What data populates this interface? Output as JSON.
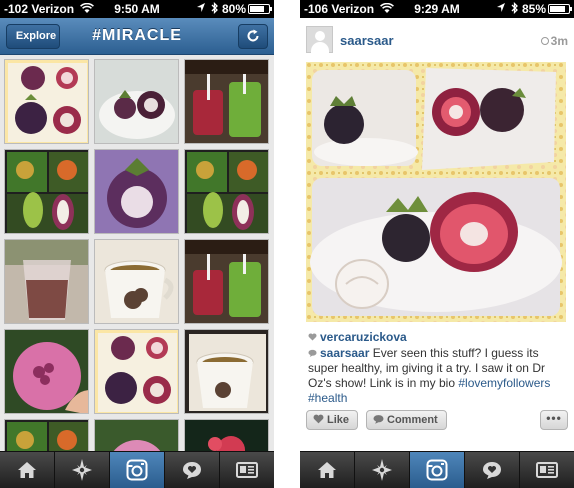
{
  "left_screen": {
    "status_bar": {
      "carrier": "-102 Verizon",
      "time": "9:50 AM",
      "battery": "80%",
      "battery_level": 0.8
    },
    "nav": {
      "back_label": "Explore",
      "title": "#MIRACLE"
    },
    "grid_tiles": [
      "mangosteen-collage",
      "mangosteen-plate",
      "juice-glasses",
      "fruit-collage",
      "mangosteen-purple",
      "fruit-collage-2",
      "smoothie-glass",
      "teacup",
      "juice-glasses-2",
      "pink-fruit-hand",
      "mangosteen-collage-2",
      "teacup-2",
      "fruit-collage-3",
      "pink-fruit-2",
      "flowers"
    ],
    "tabs": [
      {
        "icon": "home-icon"
      },
      {
        "icon": "explore-star-icon"
      },
      {
        "icon": "camera-icon",
        "active": true
      },
      {
        "icon": "activity-heart-icon"
      },
      {
        "icon": "profile-card-icon"
      }
    ]
  },
  "right_screen": {
    "status_bar": {
      "carrier": "-106 Verizon",
      "time": "9:29 AM",
      "battery": "85%",
      "battery_level": 0.85
    },
    "post": {
      "username": "saarsaar",
      "time_ago": "3m",
      "likes_user": "vercaruzickova",
      "caption_user": "saarsaar",
      "caption_text": "Ever seen this stuff? I guess its super healthy, im giving it a try. I saw it on Dr Oz's show! Link is in my bio",
      "tags": [
        "#lovemyfollowers",
        "#health"
      ]
    },
    "actions": {
      "like_label": "Like",
      "comment_label": "Comment",
      "more_label": "•••"
    },
    "tabs": [
      {
        "icon": "home-icon"
      },
      {
        "icon": "explore-star-icon"
      },
      {
        "icon": "camera-icon",
        "active": true
      },
      {
        "icon": "activity-heart-icon"
      },
      {
        "icon": "profile-card-icon"
      }
    ]
  }
}
